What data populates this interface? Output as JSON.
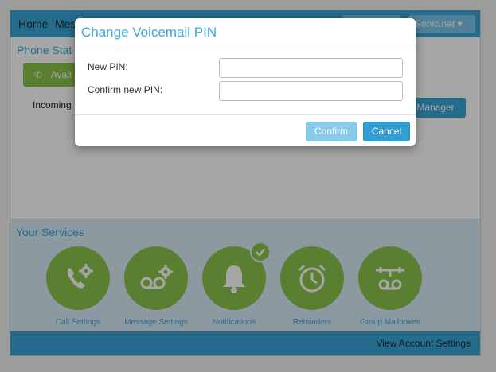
{
  "nav": {
    "home": "Home",
    "messages_partial": "Mes",
    "account": "Sonic.net"
  },
  "phone_status": {
    "title_partial": "Phone Stat",
    "status_button_partial": "Avail",
    "incoming_partial": "Incoming",
    "manager_button_partial": "Manager"
  },
  "services": {
    "title": "Your Services",
    "items": [
      {
        "label": "Call Settings",
        "icon": "phone-gear-icon"
      },
      {
        "label": "Message Settings",
        "icon": "voicemail-gear-icon"
      },
      {
        "label": "Notifications",
        "icon": "bell-icon"
      },
      {
        "label": "Reminders",
        "icon": "alarm-clock-icon"
      },
      {
        "label": "Group Mailboxes",
        "icon": "group-voicemail-icon"
      }
    ]
  },
  "footer": {
    "account_settings": "View Account Settings"
  },
  "modal": {
    "title": "Change Voicemail PIN",
    "new_pin_label": "New PIN:",
    "new_pin_value": "",
    "confirm_pin_label": "Confirm new PIN:",
    "confirm_pin_value": "",
    "confirm_button": "Confirm",
    "cancel_button": "Cancel"
  },
  "colors": {
    "accent": "#3aa6d8",
    "green": "#8bc34a",
    "services_bg": "#d8ecf7"
  }
}
